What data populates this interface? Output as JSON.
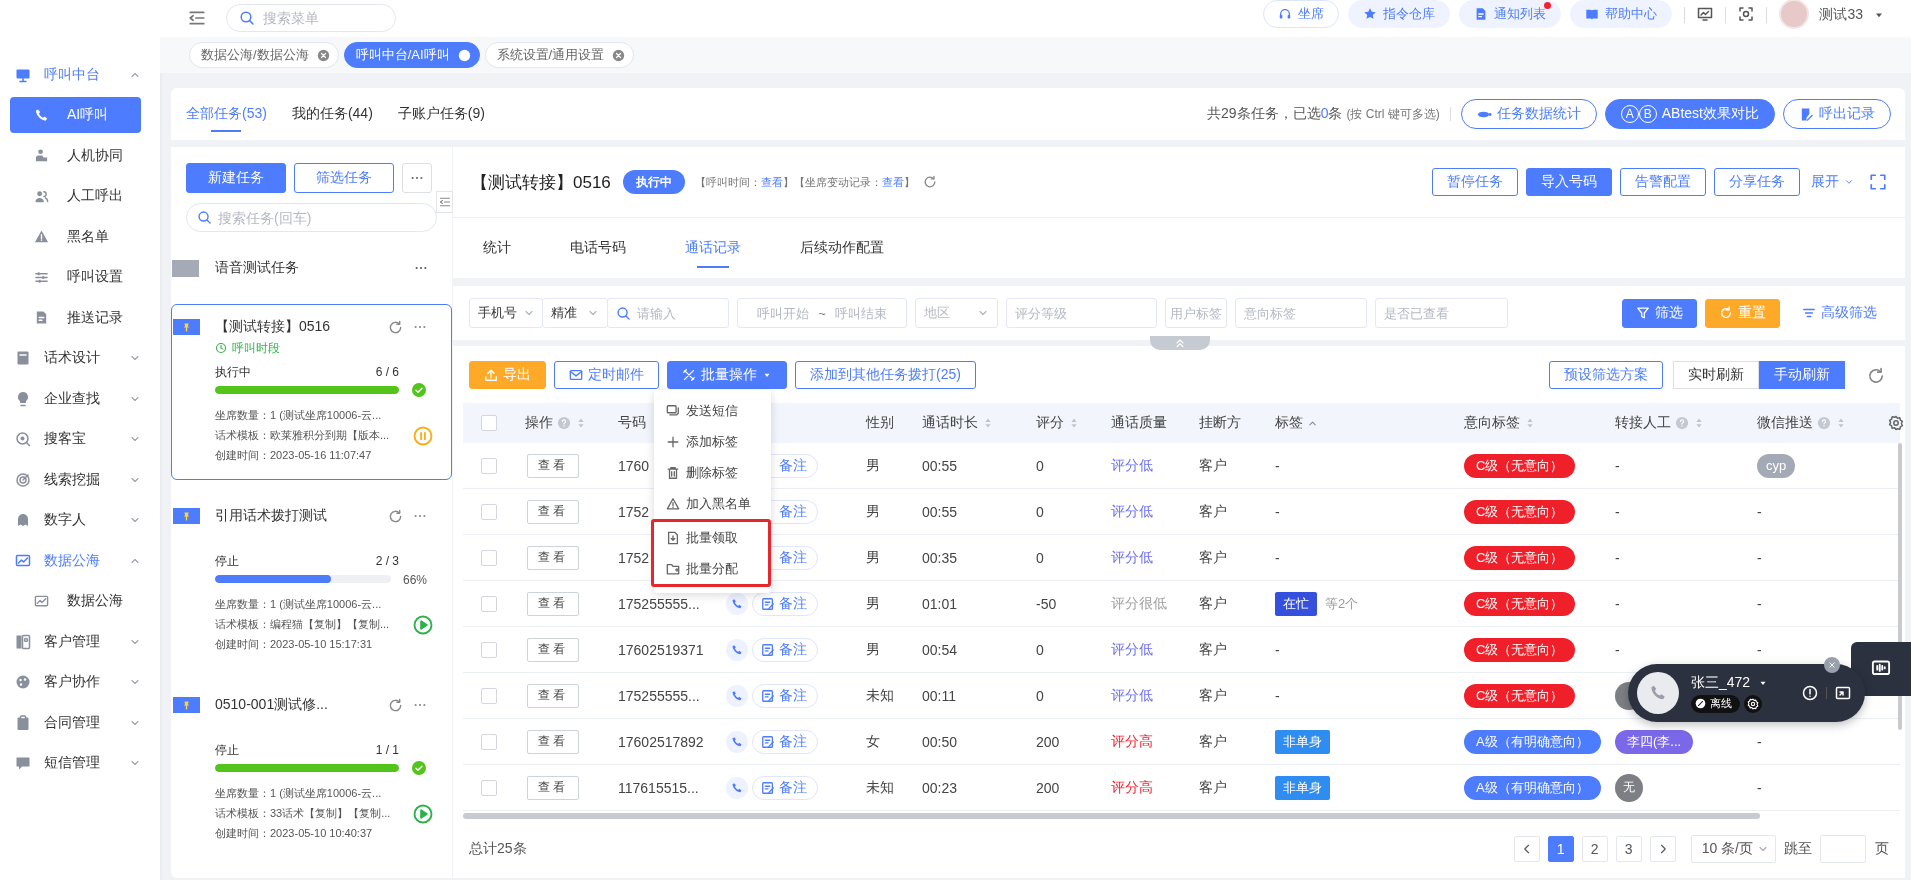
{
  "sidebar": {
    "items": [
      {
        "label": "呼叫中台",
        "expanded": true,
        "children": [
          {
            "label": "AI呼叫",
            "selected": true
          },
          {
            "label": "人机协同",
            "selected": false
          },
          {
            "label": "人工呼出",
            "selected": false
          },
          {
            "label": "黑名单",
            "selected": false
          },
          {
            "label": "呼叫设置",
            "selected": false
          },
          {
            "label": "推送记录",
            "selected": false
          }
        ]
      },
      {
        "label": "话术设计",
        "expanded": false
      },
      {
        "label": "企业查找",
        "expanded": false
      },
      {
        "label": "搜客宝",
        "expanded": false
      },
      {
        "label": "线索挖掘",
        "expanded": false
      },
      {
        "label": "数字人",
        "expanded": false
      },
      {
        "label": "数据公海",
        "expanded": true,
        "children": [
          {
            "label": "数据公海",
            "selected": false
          }
        ]
      },
      {
        "label": "客户管理",
        "expanded": false
      },
      {
        "label": "客户协作",
        "expanded": false
      },
      {
        "label": "合同管理",
        "expanded": false
      },
      {
        "label": "短信管理",
        "expanded": false
      }
    ]
  },
  "topbar": {
    "search": {
      "placeholder": "搜索菜单"
    },
    "links": [
      {
        "label": "坐席",
        "kind": "outline",
        "unread": false
      },
      {
        "label": "指令仓库",
        "kind": "soft",
        "unread": false
      },
      {
        "label": "通知列表",
        "kind": "soft",
        "unread": true
      },
      {
        "label": "帮助中心",
        "kind": "soft",
        "unread": false
      }
    ],
    "user": {
      "name": "测试33"
    }
  },
  "page_tabs": [
    {
      "label": "数据公海/数据公海",
      "selected": false
    },
    {
      "label": "呼叫中台/AI呼叫",
      "selected": true
    },
    {
      "label": "系统设置/通用设置",
      "selected": false
    }
  ],
  "task_header": {
    "tabs": [
      {
        "label": "全部任务(53)",
        "selected": true
      },
      {
        "label": "我的任务(44)",
        "selected": false
      },
      {
        "label": "子账户任务(9)",
        "selected": false
      }
    ],
    "summary": {
      "text": "共29条任务，已选",
      "count": "0",
      "unit": "条",
      "hint": "(按 Ctrl 键可多选)"
    },
    "buttons": [
      {
        "label": "任务数据统计",
        "kind": "outline"
      },
      {
        "label": "ABtest效果对比",
        "kind": "filled",
        "marks": [
          "A",
          "B"
        ]
      },
      {
        "label": "呼出记录",
        "kind": "outline"
      }
    ]
  },
  "task_list": {
    "buttons": [
      {
        "label": "新建任务",
        "kind": "filled"
      },
      {
        "label": "筛选任务",
        "kind": "outline"
      }
    ],
    "search": {
      "placeholder": "搜索任务(回车)"
    },
    "tasks": [
      {
        "kind": "group",
        "title": "语音测试任务"
      },
      {
        "kind": "task",
        "title": "【测试转接】0516",
        "selected": true,
        "schedule": "呼叫时段",
        "status": "执行中",
        "count": "6 / 6",
        "level": 1,
        "color": "#52c41a",
        "done": true,
        "lines": [
          "坐席数量：1 (测试坐席10006-云...",
          "话术模板：欧莱雅积分到期【版本...",
          "创建时间：2023-05-16 11:07:47"
        ],
        "running": true
      },
      {
        "kind": "task",
        "title": "引用话术拨打测试",
        "selected": false,
        "status": "停止",
        "count": "2 / 3",
        "level": 0.66,
        "color": "#4d7cfe",
        "done": false,
        "percent": "66%",
        "lines": [
          "坐席数量：1 (测试坐席10006-云...",
          "话术模板：编程猫【复制】【复制...",
          "创建时间：2023-05-10 15:17:31"
        ],
        "running": false
      },
      {
        "kind": "task",
        "title": "0510-001测试修...",
        "selected": false,
        "status": "停止",
        "count": "1 / 1",
        "level": 1,
        "color": "#52c41a",
        "done": true,
        "lines": [
          "坐席数量：1 (测试坐席10006-云...",
          "话术模板：33话术【复制】【复制...",
          "创建时间：2023-05-10 10:40:37"
        ],
        "running": false
      }
    ]
  },
  "detail": {
    "title": "【测试转接】0516",
    "status": "执行中",
    "meta": [
      {
        "kind": "text",
        "text": "【呼叫时间："
      },
      {
        "kind": "link",
        "text": "查看"
      },
      {
        "kind": "text",
        "text": "】【坐席变动记录："
      },
      {
        "kind": "link",
        "text": "查看"
      },
      {
        "kind": "text",
        "text": "】"
      }
    ],
    "actions": [
      {
        "label": "暂停任务",
        "kind": "outline"
      },
      {
        "label": "导入号码",
        "kind": "filled"
      },
      {
        "label": "告警配置",
        "kind": "outline"
      },
      {
        "label": "分享任务",
        "kind": "outline"
      },
      {
        "label": "展开",
        "kind": "link"
      }
    ],
    "tabs": [
      {
        "label": "统计",
        "selected": false
      },
      {
        "label": "电话号码",
        "selected": false
      },
      {
        "label": "通话记录",
        "selected": true
      },
      {
        "label": "后续动作配置",
        "selected": false
      }
    ],
    "filters": [
      {
        "kind": "select",
        "value": "手机号"
      },
      {
        "kind": "select",
        "value": "精准"
      },
      {
        "kind": "search",
        "placeholder": "请输入"
      },
      {
        "kind": "range",
        "placeholder": "呼叫开始",
        "separator": "~",
        "placeholder_end": "呼叫结束"
      },
      {
        "kind": "select",
        "placeholder": "地区"
      },
      {
        "kind": "input",
        "placeholder": "评分等级"
      },
      {
        "kind": "input",
        "placeholder": "用户标签"
      },
      {
        "kind": "input",
        "placeholder": "意向标签"
      },
      {
        "kind": "input",
        "placeholder": "是否已查看"
      }
    ],
    "filter_buttons": [
      {
        "label": "筛选",
        "kind": "filled"
      },
      {
        "label": "重置",
        "kind": "warning"
      },
      {
        "label": "高级筛选",
        "kind": "link"
      }
    ],
    "toolbar": {
      "buttons": [
        {
          "label": "导出",
          "kind": "warning",
          "expanded": false
        },
        {
          "label": "定时邮件",
          "kind": "outline",
          "expanded": false
        },
        {
          "label": "批量操作",
          "kind": "filled",
          "expanded": true
        },
        {
          "label": "添加到其他任务拨打(25)",
          "kind": "outline",
          "expanded": false
        }
      ],
      "presets": {
        "label": "预设筛选方案"
      },
      "refresh_modes": [
        {
          "label": "实时刷新",
          "selected": false
        },
        {
          "label": "手动刷新",
          "selected": true
        }
      ]
    },
    "menu": [
      {
        "label": "发送短信",
        "highlighted": false
      },
      {
        "label": "添加标签",
        "highlighted": false
      },
      {
        "label": "删除标签",
        "highlighted": false
      },
      {
        "label": "加入黑名单",
        "highlighted": false
      },
      {
        "label": "批量领取",
        "highlighted": true
      },
      {
        "label": "批量分配",
        "highlighted": true
      }
    ],
    "table": {
      "all_checked": false,
      "columns": [
        {
          "label": "操作",
          "help": true,
          "kind": "sortable"
        },
        {
          "label": "号码",
          "kind": "plain"
        },
        {
          "label": "性别",
          "kind": "plain"
        },
        {
          "label": "通话时长",
          "kind": "sortable"
        },
        {
          "label": "评分",
          "kind": "sortable"
        },
        {
          "label": "通话质量",
          "kind": "plain"
        },
        {
          "label": "挂断方",
          "kind": "plain"
        },
        {
          "label": "标签",
          "kind": "ascending"
        },
        {
          "label": "意向标签",
          "kind": "sortable"
        },
        {
          "label": "转接人工",
          "help": true,
          "kind": "sortable"
        },
        {
          "label": "微信推送",
          "help": true,
          "kind": "sortable"
        }
      ],
      "rows": [
        {
          "checked": false,
          "action": "查看",
          "number": "1760",
          "dial": false,
          "note": "备注",
          "gender": "男",
          "duration": "00:55",
          "score": "0",
          "quality": {
            "text": "评分低",
            "color": "#6b6ff2"
          },
          "hangup": "客户",
          "tag": {
            "kind": "text",
            "text": "-"
          },
          "intent": {
            "text": "C级（无意向）",
            "color": "#f0202a"
          },
          "transfer": {
            "kind": "text",
            "text": "-"
          },
          "wechat": {
            "kind": "pill",
            "text": "cyp"
          }
        },
        {
          "checked": false,
          "action": "查看",
          "number": "1752",
          "dial": false,
          "note": "备注",
          "gender": "男",
          "duration": "00:55",
          "score": "0",
          "quality": {
            "text": "评分低",
            "color": "#6b6ff2"
          },
          "hangup": "客户",
          "tag": {
            "kind": "text",
            "text": "-"
          },
          "intent": {
            "text": "C级（无意向）",
            "color": "#f0202a"
          },
          "transfer": {
            "kind": "text",
            "text": "-"
          },
          "wechat": {
            "kind": "text",
            "text": "-"
          }
        },
        {
          "checked": false,
          "action": "查看",
          "number": "1752",
          "dial": false,
          "note": "备注",
          "gender": "男",
          "duration": "00:35",
          "score": "0",
          "quality": {
            "text": "评分低",
            "color": "#6b6ff2"
          },
          "hangup": "客户",
          "tag": {
            "kind": "text",
            "text": "-"
          },
          "intent": {
            "text": "C级（无意向）",
            "color": "#f0202a"
          },
          "transfer": {
            "kind": "text",
            "text": "-"
          },
          "wechat": {
            "kind": "text",
            "text": "-"
          }
        },
        {
          "checked": false,
          "action": "查看",
          "number": "175255555...",
          "dial": true,
          "note": "备注",
          "gender": "男",
          "duration": "01:01",
          "score": "-50",
          "quality": {
            "text": "评分很低",
            "color": "#a0a0a0"
          },
          "hangup": "客户",
          "tag": {
            "kind": "tag",
            "text": "在忙",
            "color": "#3550dc",
            "more": "等2个"
          },
          "intent": {
            "text": "C级（无意向）",
            "color": "#f0202a"
          },
          "transfer": {
            "kind": "text",
            "text": "-"
          },
          "wechat": {
            "kind": "text",
            "text": "-"
          }
        },
        {
          "checked": false,
          "action": "查看",
          "number": "17602519371",
          "dial": true,
          "note": "备注",
          "gender": "男",
          "duration": "00:54",
          "score": "0",
          "quality": {
            "text": "评分低",
            "color": "#6b6ff2"
          },
          "hangup": "客户",
          "tag": {
            "kind": "text",
            "text": "-"
          },
          "intent": {
            "text": "C级（无意向）",
            "color": "#f0202a"
          },
          "transfer": {
            "kind": "text",
            "text": "-"
          },
          "wechat": {
            "kind": "text",
            "text": "-"
          }
        },
        {
          "checked": false,
          "action": "查看",
          "number": "175255555...",
          "dial": true,
          "note": "备注",
          "gender": "未知",
          "duration": "00:11",
          "score": "0",
          "quality": {
            "text": "评分低",
            "color": "#6b6ff2"
          },
          "hangup": "客户",
          "tag": {
            "kind": "text",
            "text": "-"
          },
          "intent": {
            "text": "C级（无意向）",
            "color": "#f0202a"
          },
          "transfer": {
            "kind": "avatar"
          }
        },
        {
          "checked": false,
          "action": "查看",
          "number": "17602517892",
          "dial": true,
          "note": "备注",
          "gender": "女",
          "duration": "00:50",
          "score": "200",
          "quality": {
            "text": "评分高",
            "color": "#f5222d"
          },
          "hangup": "客户",
          "tag": {
            "kind": "tag",
            "text": "非单身",
            "color": "#2f8cf0"
          },
          "intent": {
            "text": "A级（有明确意向）",
            "color": "#4d7cfe"
          },
          "transfer": {
            "kind": "pill",
            "text": "李四(李...",
            "color": "#7b68e8"
          },
          "wechat": {
            "kind": "text",
            "text": "-"
          }
        },
        {
          "checked": false,
          "action": "查看",
          "number": "117615515...",
          "dial": true,
          "note": "备注",
          "gender": "未知",
          "duration": "00:23",
          "score": "200",
          "quality": {
            "text": "评分高",
            "color": "#f5222d"
          },
          "hangup": "客户",
          "tag": {
            "kind": "tag",
            "text": "非单身",
            "color": "#2f8cf0"
          },
          "intent": {
            "text": "A级（有明确意向）",
            "color": "#4d7cfe"
          },
          "transfer": {
            "kind": "avatar",
            "text": "无"
          },
          "wechat": {
            "kind": "text",
            "text": "-"
          }
        }
      ]
    },
    "pagination": {
      "total": "总计25条",
      "pages": [
        {
          "label": "1",
          "selected": true
        },
        {
          "label": "2",
          "selected": false
        },
        {
          "label": "3",
          "selected": false
        }
      ],
      "page_size": "10 条/页",
      "jump_label": "跳至",
      "page_suffix": "页"
    }
  },
  "call_widget": {
    "name": "张三_472",
    "status": "离线"
  }
}
